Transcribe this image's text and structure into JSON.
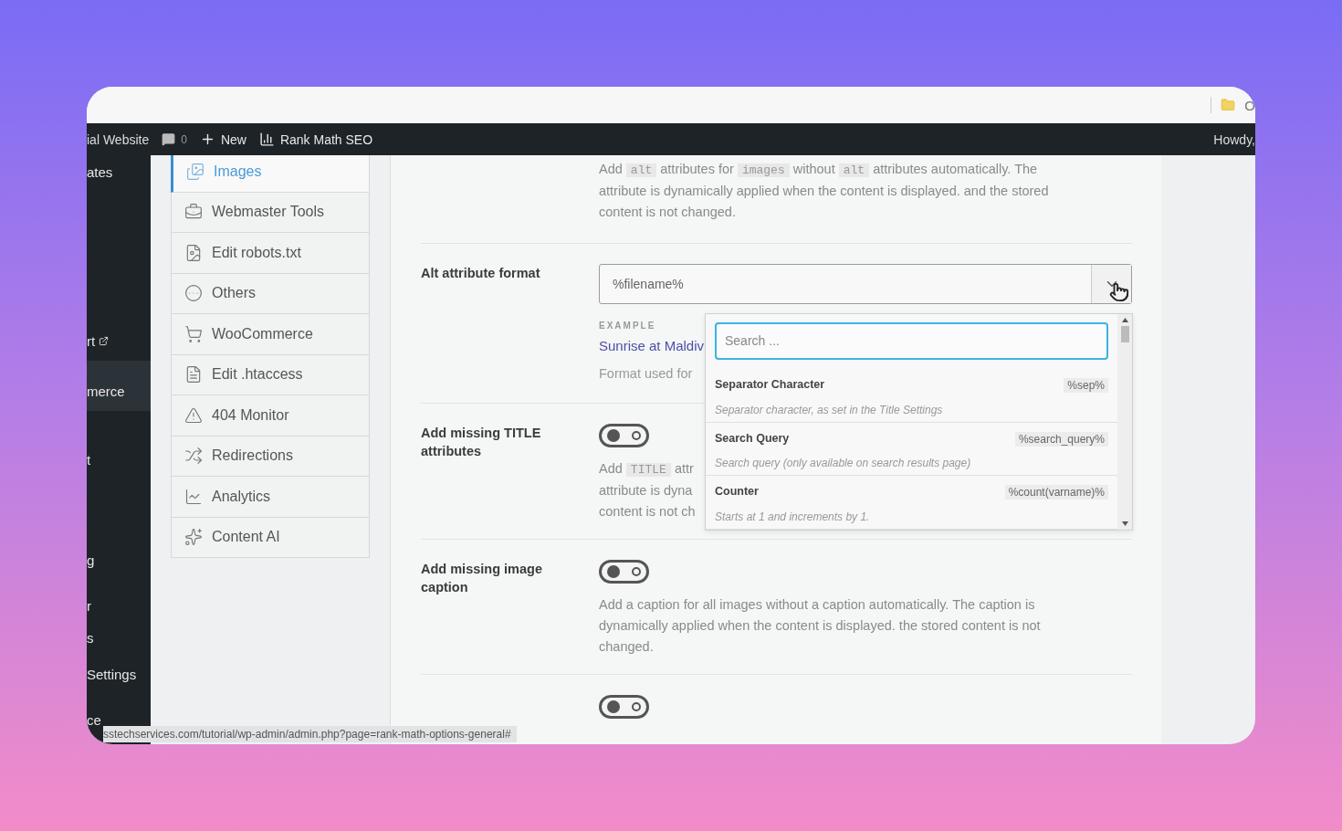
{
  "browser_bar": {
    "text": "O"
  },
  "admin_bar": {
    "site": "ial Website",
    "comments": "0",
    "new": "New",
    "plugin": "Rank Math SEO",
    "howdy": "Howdy,"
  },
  "wp_menu": [
    "ates",
    "rt",
    "merce",
    "t",
    "g",
    "r",
    "s",
    "Settings",
    "ce"
  ],
  "nav": [
    {
      "label": "Images",
      "selected": true
    },
    {
      "label": "Webmaster Tools",
      "selected": false
    },
    {
      "label": "Edit robots.txt",
      "selected": false
    },
    {
      "label": "Others",
      "selected": false
    },
    {
      "label": "WooCommerce",
      "selected": false
    },
    {
      "label": "Edit .htaccess",
      "selected": false
    },
    {
      "label": "404 Monitor",
      "selected": false
    },
    {
      "label": "Redirections",
      "selected": false
    },
    {
      "label": "Analytics",
      "selected": false
    },
    {
      "label": "Content AI",
      "selected": false
    }
  ],
  "settings": [
    {
      "kind": "description",
      "lines": [
        [
          {
            "t": "Add "
          },
          {
            "t": "alt",
            "code": true
          },
          {
            "t": " attributes for "
          },
          {
            "t": "images",
            "code": true
          },
          {
            "t": " without "
          },
          {
            "t": "alt",
            "code": true
          },
          {
            "t": " attributes automatically. The"
          }
        ],
        [
          {
            "t": "attribute is dynamically applied when the content is displayed. and the stored"
          }
        ],
        [
          {
            "t": "content is not changed."
          }
        ]
      ]
    },
    {
      "kind": "select",
      "label": "Alt attribute format",
      "value": "%filename%",
      "example_label": "EXAMPLE",
      "example": "Sunrise at Maldiv",
      "note": "Format used for",
      "dropdown": {
        "placeholder": "Search ...",
        "options": [
          {
            "title": "Separator Character",
            "desc": "Separator character, as set in the Title Settings",
            "tag": "%sep%"
          },
          {
            "title": "Search Query",
            "desc": "Search query (only available on search results page)",
            "tag": "%search_query%"
          },
          {
            "title": "Counter",
            "desc": "Starts at 1 and increments by 1.",
            "tag": "%count(varname)%"
          }
        ]
      }
    },
    {
      "kind": "toggle",
      "label": "Add missing TITLE attributes",
      "on": false,
      "lines": [
        [
          {
            "t": "Add "
          },
          {
            "t": "TITLE",
            "code": true
          },
          {
            "t": " attr"
          }
        ],
        [
          {
            "t": "attribute is dyna"
          }
        ],
        [
          {
            "t": "content is not ch"
          }
        ]
      ]
    },
    {
      "kind": "toggle",
      "label": "Add missing image caption",
      "on": false,
      "lines": [
        [
          {
            "t": "Add a caption for all images without a caption automatically. The caption is"
          }
        ],
        [
          {
            "t": "dynamically applied when the content is displayed. the stored content is not"
          }
        ],
        [
          {
            "t": "changed."
          }
        ]
      ]
    },
    {
      "kind": "toggle_cut",
      "on": false
    }
  ],
  "status_url": "sstechservices.com/tutorial/wp-admin/admin.php?page=rank-math-options-general#"
}
